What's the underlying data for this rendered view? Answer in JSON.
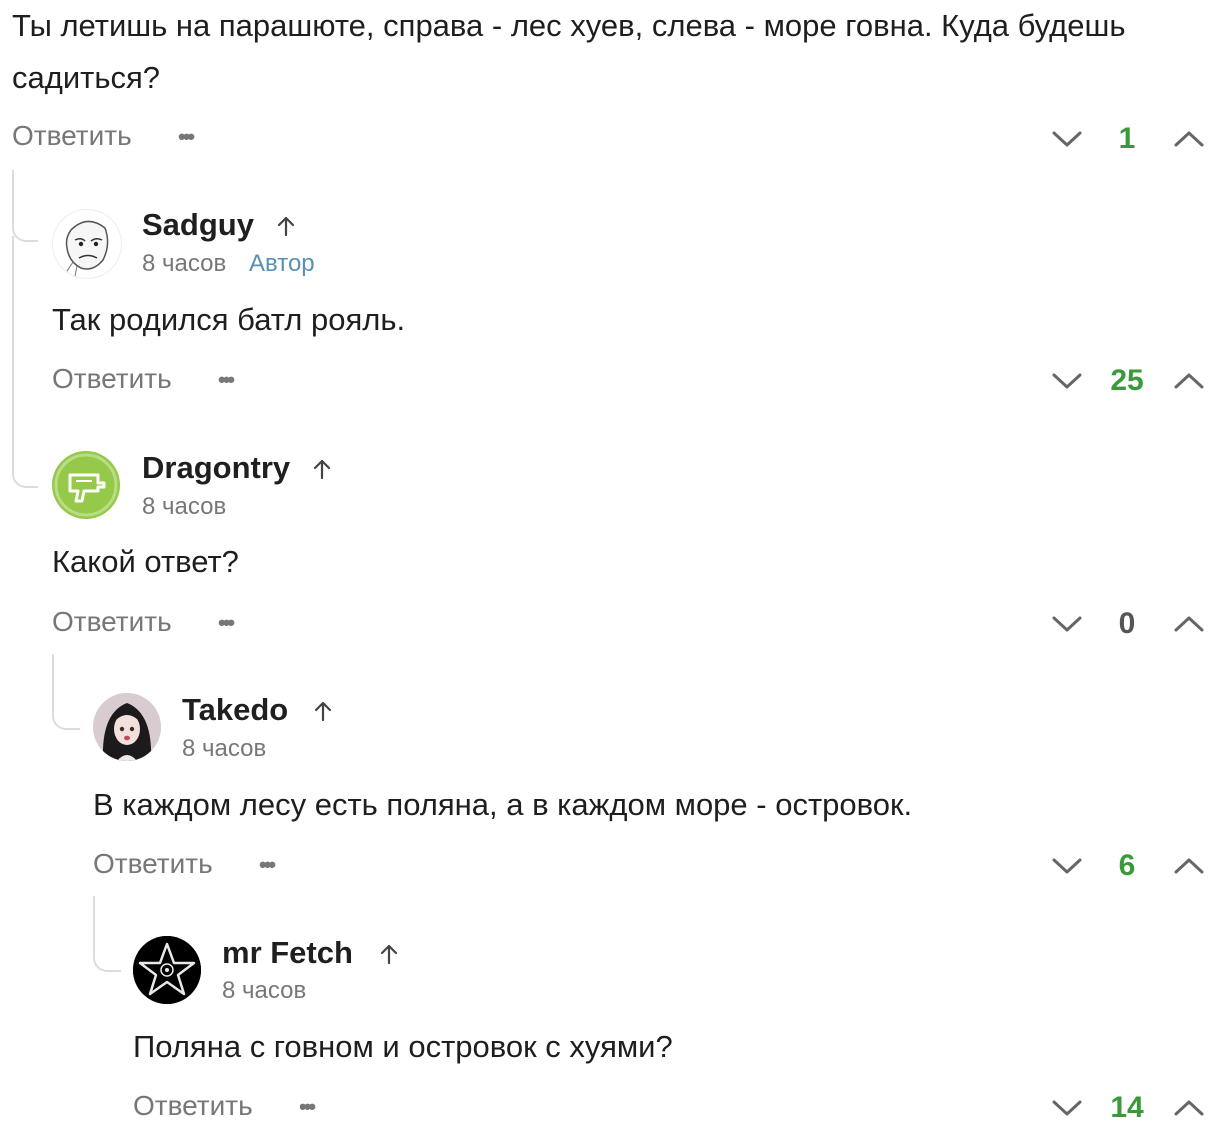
{
  "root": {
    "text": "Ты летишь на парашюте, справа - лес хуев, слева - море говна. Куда будешь садиться?",
    "reply_label": "Ответить",
    "score": "1"
  },
  "comments": [
    {
      "username": "Sadguy",
      "time": "8 часов",
      "badge": "Автор",
      "text": "Так родился батл рояль.",
      "reply_label": "Ответить",
      "score": "25",
      "avatar_icon": "sad-face-meme-avatar"
    },
    {
      "username": "Dragontry",
      "time": "8 часов",
      "text": "Какой ответ?",
      "reply_label": "Ответить",
      "score": "0",
      "avatar_icon": "drill-avatar"
    },
    {
      "username": "Takedo",
      "time": "8 часов",
      "text": "В каждом лесу есть поляна, а в каждом море - островок.",
      "reply_label": "Ответить",
      "score": "6",
      "avatar_icon": "anime-girl-avatar"
    },
    {
      "username": "mr Fetch",
      "time": "8 часов",
      "text": "Поляна с говном и островок с хуями?",
      "reply_label": "Ответить",
      "score": "14",
      "avatar_icon": "pentagram-avatar"
    }
  ],
  "colors": {
    "score_positive": "#3a9a3a",
    "score_zero": "#555555",
    "author_badge": "#5b8fb3",
    "muted": "#777777",
    "thread_line": "#dcdcdc"
  }
}
